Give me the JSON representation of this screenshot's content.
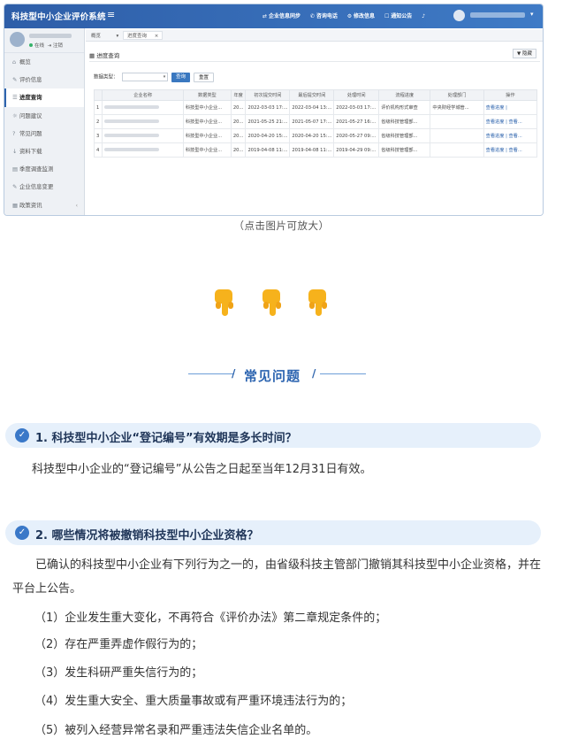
{
  "app": {
    "title": "科技型中小企业评价系统",
    "menu_icon": "hamburger-icon",
    "top_nav": [
      "企业信息同步",
      "咨询电话",
      "修改信息",
      "通知公告"
    ],
    "user_caret": "▾"
  },
  "sidebar": {
    "status_online": "在线",
    "status_logout": "注销",
    "items": [
      {
        "icon": "home-icon",
        "label": "概览"
      },
      {
        "icon": "edit-icon",
        "label": "评价信息"
      },
      {
        "icon": "list-icon",
        "label": "进度查询"
      },
      {
        "icon": "lightbulb-icon",
        "label": "问题建议"
      },
      {
        "icon": "help-icon",
        "label": "常见问题"
      },
      {
        "icon": "download-icon",
        "label": "资料下载"
      },
      {
        "icon": "survey-icon",
        "label": "季度调查监测"
      },
      {
        "icon": "edit-icon",
        "label": "企业信息变更"
      },
      {
        "icon": "news-icon",
        "label": "政策资讯"
      }
    ],
    "active_index": 2,
    "collapse_glyph": "‹"
  },
  "tabs": [
    {
      "label": "概览",
      "glyph": "▾"
    },
    {
      "label": "进度查询",
      "glyph": "×"
    }
  ],
  "panel": {
    "title": "进度查询",
    "hide_button": "隐藏",
    "filter_label": "数据类型：",
    "query_button": "查询",
    "reset_button": "重置"
  },
  "table": {
    "headers": [
      "",
      "企业名称",
      "数据类型",
      "年度",
      "初次提交时间",
      "最后提交时间",
      "处理时间",
      "流程进度",
      "处理部门",
      "操作"
    ],
    "rows": [
      [
        "1",
        "",
        "科技型中小企业...",
        "20...",
        "2022-03-03 17:...",
        "2022-03-04 13:...",
        "2022-03-03 17:...",
        "评价机构形式审查",
        "中央财经学城管...",
        "查看进度 |"
      ],
      [
        "2",
        "",
        "科技型中小企业...",
        "20...",
        "2021-05-25 21:...",
        "2021-05-07 17:...",
        "2021-05-27 16:...",
        "省级科技管理部...",
        "",
        "查看进度 | 查看..."
      ],
      [
        "3",
        "",
        "科技型中小企业...",
        "20...",
        "2020-04-20 15:...",
        "2020-04-20 15:...",
        "2020-05-27 09:...",
        "省级科技管理部...",
        "",
        "查看进度 | 查看..."
      ],
      [
        "4",
        "",
        "科技型中小企业...",
        "20...",
        "2019-04-08 11:...",
        "2019-04-08 11:...",
        "2019-04-29 09:...",
        "省级科技管理部...",
        "",
        "查看进度 | 查看..."
      ]
    ]
  },
  "caption": "（点击图片可放大）",
  "faq": {
    "title": "常见问题",
    "q1": {
      "question": "1. 科技型中小企业“登记编号”有效期是多长时间？",
      "answer": "科技型中小企业的“登记编号”从公告之日起至当年12月31日有效。"
    },
    "q2": {
      "question": "2. 哪些情况将被撤销科技型中小企业资格？",
      "intro": "已确认的科技型中小企业有下列行为之一的，由省级科技主管部门撤销其科技型中小企业资格，并在平台上公告。",
      "items": [
        "（1）企业发生重大变化，不再符合《评价办法》第二章规定条件的；",
        "（2）存在严重弄虚作假行为的；",
        "（3）发生科研严重失信行为的；",
        "（4）发生重大安全、重大质量事故或有严重环境违法行为的；",
        "（5）被列入经营异常名录和严重违法失信企业名单的。"
      ]
    }
  },
  "colors": {
    "brand_blue": "#2e5ea8",
    "faq_bar": "#e6f0fb",
    "hand_yellow": "#f6b21c"
  }
}
